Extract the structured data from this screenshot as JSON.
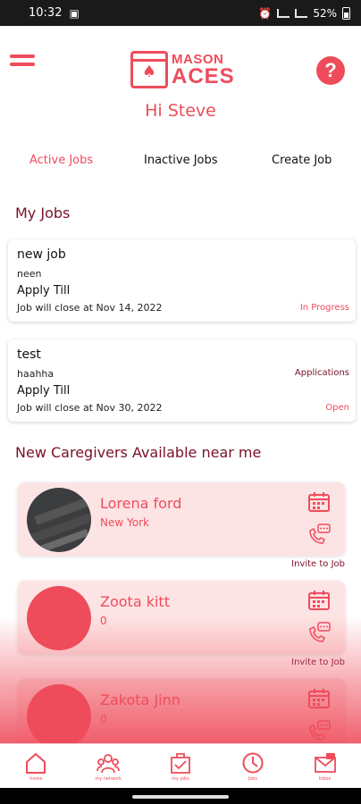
{
  "status_bar": {
    "time": "10:32",
    "battery": "52%",
    "left_icons": "▣"
  },
  "header": {
    "logo_line1": "MASON",
    "logo_line2": "ACES",
    "greeting": "Hi Steve"
  },
  "tabs": [
    {
      "label": "Active Jobs",
      "active": true
    },
    {
      "label": "Inactive Jobs",
      "active": false
    },
    {
      "label": "Create Job",
      "active": false
    }
  ],
  "my_jobs": {
    "title": "My Jobs",
    "jobs": [
      {
        "title": "new job",
        "description": "neen",
        "apply_label": "Apply Till",
        "close_text": "Job will close at Nov 14, 2022",
        "status": "In Progress",
        "applications": ""
      },
      {
        "title": "test",
        "description": "haahha",
        "apply_label": "Apply Till",
        "close_text": "Job will close at Nov 30, 2022",
        "status": "Open",
        "applications": "Applications"
      }
    ]
  },
  "caregivers": {
    "title": "New Caregivers Available near me",
    "items": [
      {
        "name": "Lorena ford",
        "location": "New York",
        "invite": "Invite to Job"
      },
      {
        "name": "Zoota kitt",
        "location": "0",
        "invite": "Invite to Job"
      },
      {
        "name": "Zakota Jinn",
        "location": "0",
        "invite": ""
      }
    ]
  },
  "bottom_nav": {
    "items": [
      {
        "label": "home",
        "icon": "home-icon"
      },
      {
        "label": "my network",
        "icon": "network-icon"
      },
      {
        "label": "my jobs",
        "icon": "jobs-icon"
      },
      {
        "label": "Jobs",
        "icon": "clock-icon"
      },
      {
        "label": "Inbox",
        "icon": "inbox-icon"
      }
    ]
  },
  "colors": {
    "accent": "#ee4c5b",
    "dark_accent": "#7a1029",
    "card_tint": "#fde4e4"
  }
}
